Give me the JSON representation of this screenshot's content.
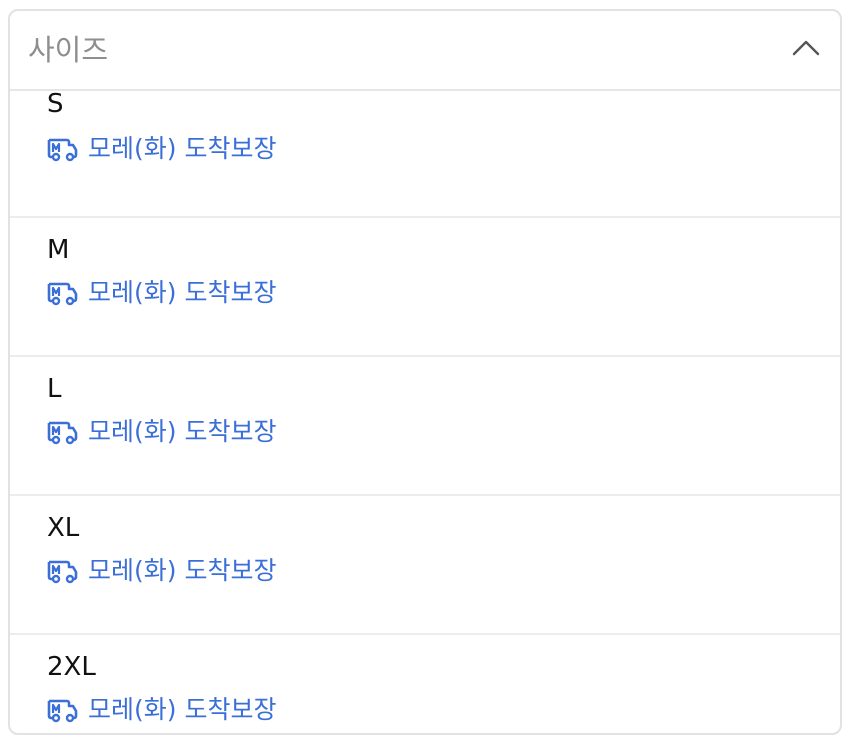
{
  "dropdown": {
    "placeholder": "사이즈",
    "expanded": true,
    "chevron_icon": "chevron-up-icon"
  },
  "options": [
    {
      "size": "S",
      "delivery": "모레(화) 도착보장"
    },
    {
      "size": "M",
      "delivery": "모레(화) 도착보장"
    },
    {
      "size": "L",
      "delivery": "모레(화) 도착보장"
    },
    {
      "size": "XL",
      "delivery": "모레(화) 도착보장"
    },
    {
      "size": "2XL",
      "delivery": "모레(화) 도착보장"
    }
  ],
  "colors": {
    "delivery_accent": "#3b6fd8",
    "placeholder_text": "#8e8e8e",
    "border": "#e2e2e2"
  },
  "icons": {
    "delivery": "delivery-truck-icon"
  }
}
